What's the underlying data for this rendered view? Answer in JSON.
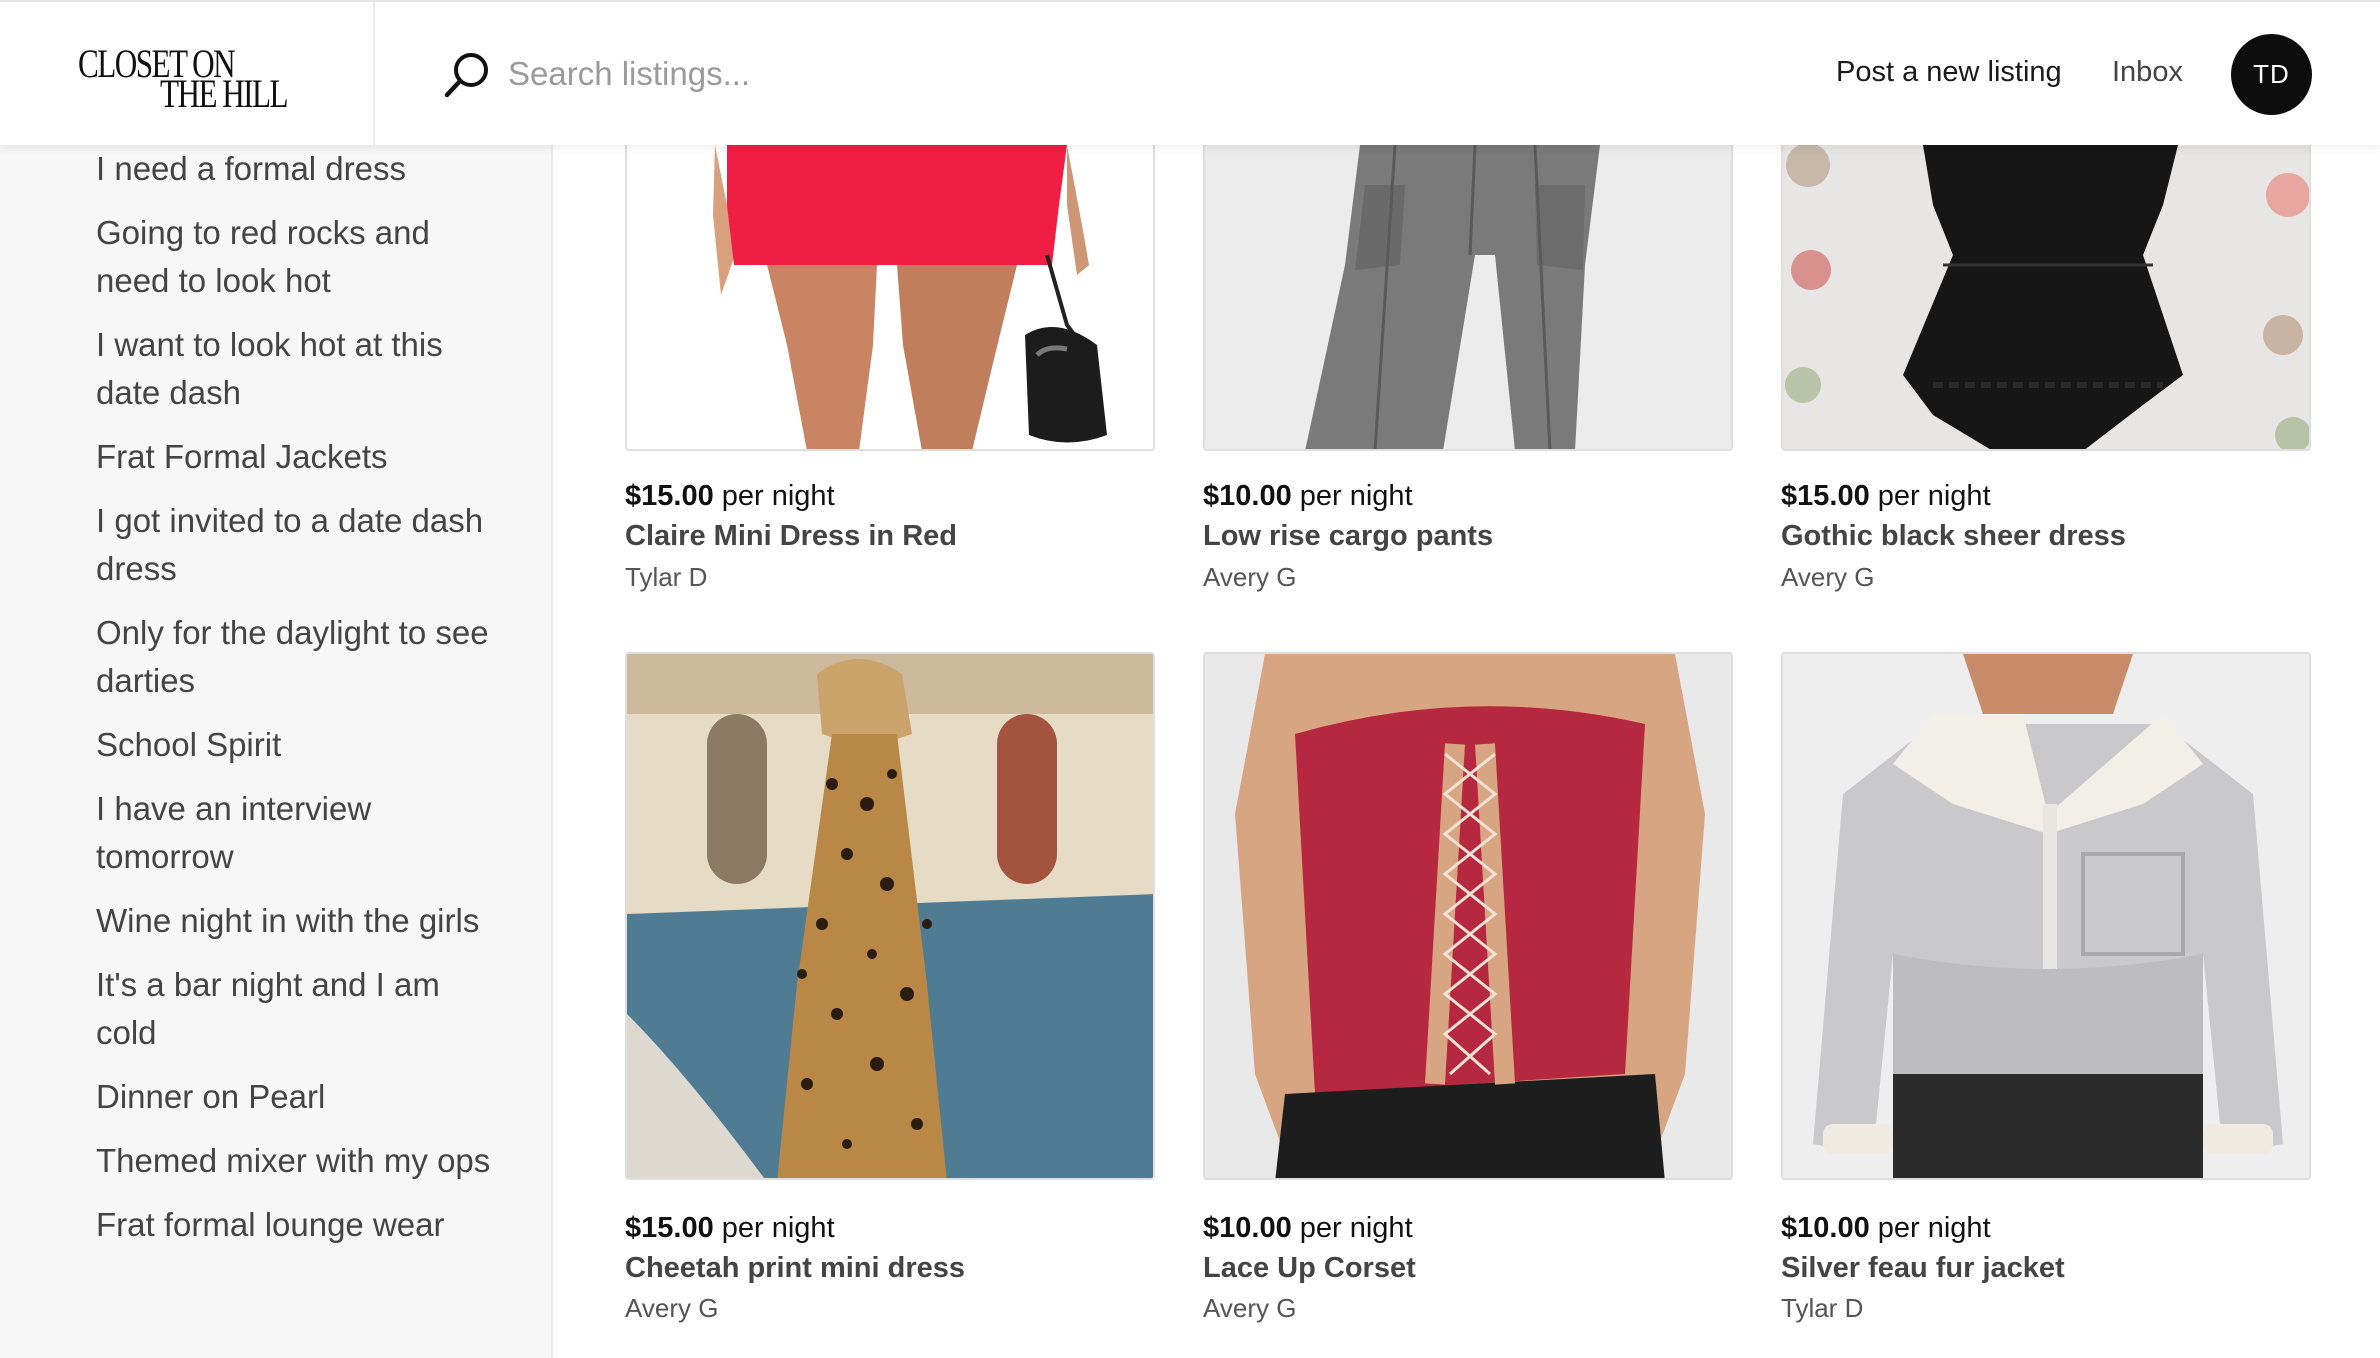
{
  "header": {
    "logo_line1": "CLOSET ON",
    "logo_line2": "THE HILL",
    "search_placeholder": "Search listings...",
    "post_label": "Post a new listing",
    "inbox_label": "Inbox",
    "avatar_initials": "TD"
  },
  "sidebar": {
    "items": [
      {
        "label": "I need a formal dress"
      },
      {
        "label": "Going to red rocks and need to look hot"
      },
      {
        "label": "I want to look hot at this date dash"
      },
      {
        "label": "Frat Formal Jackets"
      },
      {
        "label": "I got invited to a date dash dress"
      },
      {
        "label": "Only for the daylight to see darties"
      },
      {
        "label": "School Spirit"
      },
      {
        "label": "I have an interview tomorrow"
      },
      {
        "label": "Wine night in with the girls"
      },
      {
        "label": "It's a bar night and I am cold"
      },
      {
        "label": "Dinner on Pearl"
      },
      {
        "label": "Themed mixer with my ops"
      },
      {
        "label": "Frat formal lounge wear"
      }
    ]
  },
  "listings": [
    {
      "price": "$15.00",
      "unit": "per night",
      "title": "Claire Mini Dress in Red",
      "owner": "Tylar D",
      "image": "red-mini-dress"
    },
    {
      "price": "$10.00",
      "unit": "per night",
      "title": "Low rise cargo pants",
      "owner": "Avery G",
      "image": "grey-cargo-pants"
    },
    {
      "price": "$15.00",
      "unit": "per night",
      "title": "Gothic black sheer dress",
      "owner": "Avery G",
      "image": "black-lace-dress"
    },
    {
      "price": "$15.00",
      "unit": "per night",
      "title": "Cheetah print mini dress",
      "owner": "Avery G",
      "image": "leopard-dress"
    },
    {
      "price": "$10.00",
      "unit": "per night",
      "title": "Lace Up Corset",
      "owner": "Avery G",
      "image": "red-corset"
    },
    {
      "price": "$10.00",
      "unit": "per night",
      "title": "Silver feau fur jacket",
      "owner": "Tylar D",
      "image": "silver-jacket"
    }
  ],
  "colors": {
    "accent": "#0d0d0d",
    "sidebar_bg": "#f7f7f7",
    "red_dress": "#f01e44",
    "corset": "#b5283f"
  }
}
